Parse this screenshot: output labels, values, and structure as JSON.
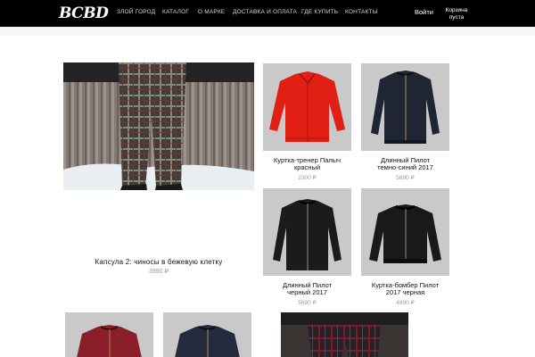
{
  "header": {
    "logo": "BCBD",
    "nav": [
      "ЗЛОЙ ГОРОД",
      "КАТАЛОГ",
      "О МАРКЕ",
      "ДОСТАВКА И ОПЛАТА",
      "ГДЕ КУПИТЬ",
      "КОНТАКТЫ"
    ],
    "login": "Войти",
    "cart_line1": "Корзина",
    "cart_line2": "пуста"
  },
  "featured": {
    "title": "Капсула 2: чиносы в бежевую клетку",
    "price": "3990 ₽"
  },
  "products": [
    {
      "name_line1": "Куртка-тренер Палыч",
      "name_line2": "красный",
      "price": "2300 ₽",
      "color": "#e21f14",
      "icon": "red-coach-jacket"
    },
    {
      "name_line1": "Длинный Пилот",
      "name_line2": "темно-синий 2017",
      "price": "5690 ₽",
      "color": "#1f2533",
      "icon": "navy-long-bomber-jacket"
    },
    {
      "name_line1": "Длинный Пилот",
      "name_line2": "черный 2017",
      "price": "5690 ₽",
      "color": "#1b1b1d",
      "icon": "black-long-bomber-jacket"
    },
    {
      "name_line1": "Куртка-бомбер Пилот",
      "name_line2": "2017 черная",
      "price": "4890 ₽",
      "color": "#19191b",
      "icon": "black-bomber-jacket"
    }
  ],
  "colors": {
    "topbar": "#000000",
    "thumb_bg": "#c9c9c9",
    "price": "#999999"
  }
}
